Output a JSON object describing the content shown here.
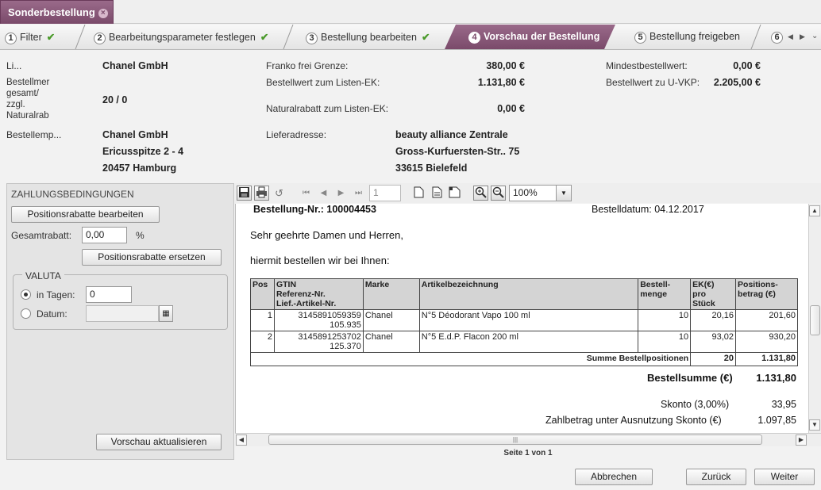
{
  "doc_tab": {
    "title": "Sonderbestellung"
  },
  "wizard": {
    "steps": [
      {
        "num": "1",
        "label": "Filter",
        "done": true
      },
      {
        "num": "2",
        "label": "Bearbeitungsparameter festlegen",
        "done": true
      },
      {
        "num": "3",
        "label": "Bestellung bearbeiten",
        "done": true
      },
      {
        "num": "4",
        "label": "Vorschau der Bestellung",
        "active": true
      },
      {
        "num": "5",
        "label": "Bestellung freigeben"
      },
      {
        "num": "6",
        "label": ""
      }
    ],
    "check": "✔"
  },
  "header": {
    "lieferant_label": "Li...",
    "lieferant_value": "Chanel GmbH",
    "bestellmenge_label": [
      "Bestellmer",
      "gesamt/",
      "zzgl.",
      "Naturalrab"
    ],
    "bestellmenge_value": "20 / 0",
    "empfaenger_label": "Bestellemp...",
    "empfaenger_lines": [
      "Chanel GmbH",
      "Ericusspitze 2 - 4",
      "20457 Hamburg"
    ],
    "franko_label": "Franko frei Grenze:",
    "franko_value": "380,00 €",
    "bestellwert_ek_label": "Bestellwert zum Listen-EK:",
    "bestellwert_ek_value": "1.131,80 €",
    "naturalrabatt_label": "Naturalrabatt zum Listen-EK:",
    "naturalrabatt_value": "0,00 €",
    "lieferadresse_label": "Lieferadresse:",
    "lieferadresse_lines": [
      "beauty alliance Zentrale",
      "Gross-Kurfuersten-Str.. 75",
      "33615 Bielefeld"
    ],
    "mindest_label": "Mindestbestellwert:",
    "mindest_value": "0,00 €",
    "uvkp_label": "Bestellwert zu U-VKP:",
    "uvkp_value": "2.205,00 €"
  },
  "payment": {
    "title": "ZAHLUNGSBEDINGUNGEN",
    "edit_button": "Positionsrabatte bearbeiten",
    "gesamtrabatt_label": "Gesamtrabatt:",
    "gesamtrabatt_value": "0,00",
    "percent": "%",
    "replace_button": "Positionsrabatte ersetzen",
    "valuta_title": "VALUTA",
    "tagen_label": "in Tagen:",
    "tagen_value": "0",
    "datum_label": "Datum:",
    "datum_value": "",
    "refresh_button": "Vorschau aktualisieren"
  },
  "viewer": {
    "page_input": "1",
    "zoom": "100%",
    "page_info": "Seite 1 von 1"
  },
  "report": {
    "order_no": "Bestellung-Nr.: 100004453",
    "order_date": "Bestelldatum: 04.12.2017",
    "greeting": "Sehr geehrte Damen und Herren,",
    "intro": "hiermit bestellen wir bei Ihnen:",
    "columns": [
      "Pos",
      "GTIN Referenz-Nr. Lief.-Artikel-Nr.",
      "Marke",
      "Artikelbezeichnung",
      "Bestell-menge",
      "EK(€) pro Stück",
      "Positions-betrag (€)"
    ],
    "col_lines": [
      [
        "Pos"
      ],
      [
        "GTIN",
        "Referenz-Nr.",
        "Lief.-Artikel-Nr."
      ],
      [
        "Marke"
      ],
      [
        "Artikelbezeichnung"
      ],
      [
        "Bestell-",
        "menge"
      ],
      [
        "EK(€)",
        "pro",
        "Stück"
      ],
      [
        "Positions-",
        "betrag (€)"
      ]
    ],
    "rows": [
      {
        "pos": "1",
        "gtin": "3145891059359",
        "ref": "105.935",
        "marke": "Chanel",
        "artikel": "N°5 Déodorant Vapo 100 ml",
        "menge": "10",
        "ek": "20,16",
        "betrag": "201,60"
      },
      {
        "pos": "2",
        "gtin": "3145891253702",
        "ref": "125.370",
        "marke": "Chanel",
        "artikel": "N°5 E.d.P. Flacon 200 ml",
        "menge": "10",
        "ek": "93,02",
        "betrag": "930,20"
      }
    ],
    "sum_label": "Summe Bestellpositionen",
    "sum_menge": "20",
    "sum_betrag": "1.131,80",
    "bestellsumme_label": "Bestellsumme (€)",
    "bestellsumme_value": "1.131,80",
    "skonto_label": "Skonto (3,00%)",
    "skonto_value": "33,95",
    "zahlbetrag_label": "Zahlbetrag unter Ausnutzung Skonto (€)",
    "zahlbetrag_value": "1.097,85"
  },
  "footer": {
    "cancel": "Abbrechen",
    "back": "Zurück",
    "next": "Weiter"
  }
}
